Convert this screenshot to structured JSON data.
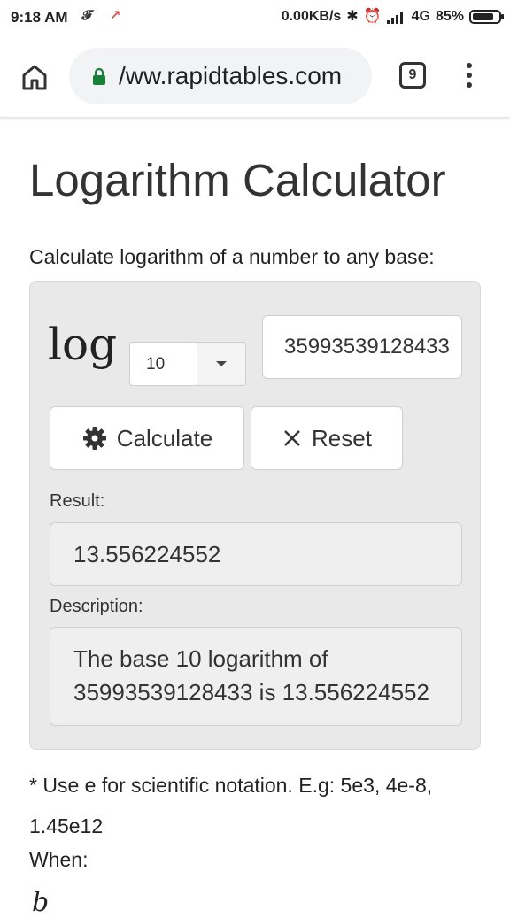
{
  "status_bar": {
    "time": "9:18 AM",
    "network_speed": "0.00KB/s",
    "network_type": "4G",
    "battery": "85%",
    "battery_level": 0.85,
    "icons": [
      "f-notification-icon",
      "missed-call-icon",
      "bluetooth-icon",
      "alarm-icon",
      "signal-icon",
      "battery-icon"
    ]
  },
  "browser": {
    "url": "www.rapidtables.com",
    "url_display": "/ww.rapidtables.com",
    "tab_count": "9",
    "lock_color": "#188038"
  },
  "page": {
    "title": "Logarithm Calculator",
    "intro": "Calculate logarithm of a number to any base:"
  },
  "calculator": {
    "log_label": "log",
    "base_value": "10",
    "number_value": "35993539128433",
    "calculate_label": "Calculate",
    "reset_label": "Reset",
    "result_label": "Result:",
    "result_value": "13.556224552",
    "description_label": "Description:",
    "description_value": "The base 10 logarithm of 35993539128433 is 13.556224552"
  },
  "notes": {
    "scientific": "* Use e for scientific notation. E.g: 5e3, 4e-8, 1.45e12",
    "when": "When:",
    "formula_partial": "b"
  },
  "colors": {
    "panel_bg": "#e9e9e9",
    "text": "#333333"
  }
}
